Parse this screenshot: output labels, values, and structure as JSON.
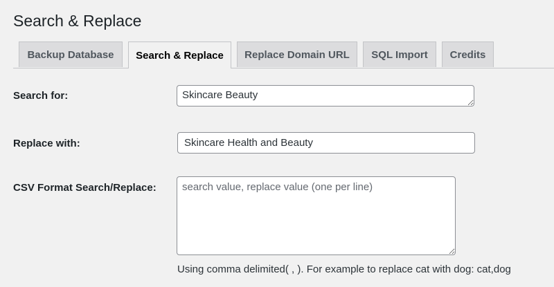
{
  "page": {
    "title": "Search & Replace"
  },
  "tabs": [
    {
      "label": "Backup Database",
      "active": false
    },
    {
      "label": "Search & Replace",
      "active": true
    },
    {
      "label": "Replace Domain URL",
      "active": false
    },
    {
      "label": "SQL Import",
      "active": false
    },
    {
      "label": "Credits",
      "active": false
    }
  ],
  "form": {
    "search_label": "Search for:",
    "search_value": "Skincare Beauty",
    "replace_label": "Replace with:",
    "replace_value": "Skincare Health and Beauty",
    "csv_label": "CSV Format Search/Replace:",
    "csv_placeholder": "search value, replace value (one per line)",
    "csv_hint": "Using comma delimited( , ). For example to replace cat with dog: cat,dog"
  },
  "colors": {
    "background": "#f1f1f1",
    "tab_inactive": "#dcdcde",
    "border": "#c3c4c7",
    "field_border": "#8c8f94"
  }
}
